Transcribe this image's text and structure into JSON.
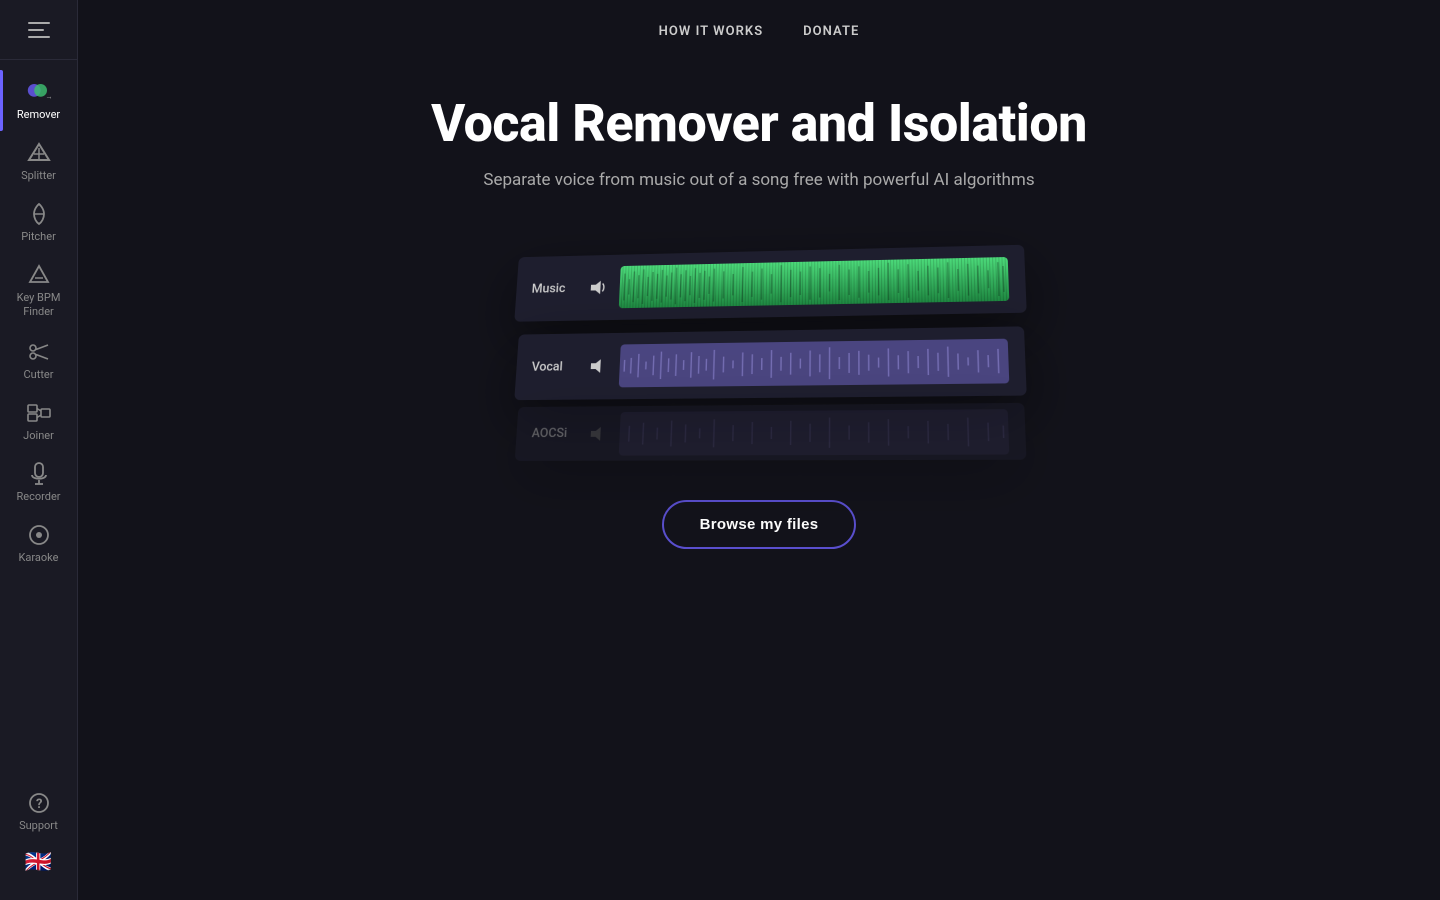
{
  "sidebar": {
    "hamburger_label": "Menu",
    "items": [
      {
        "id": "remover",
        "label": "Remover",
        "active": true
      },
      {
        "id": "splitter",
        "label": "Splitter",
        "active": false
      },
      {
        "id": "pitcher",
        "label": "Pitcher",
        "active": false
      },
      {
        "id": "keybpm",
        "label": "Key BPM Finder",
        "active": false
      },
      {
        "id": "cutter",
        "label": "Cutter",
        "active": false
      },
      {
        "id": "joiner",
        "label": "Joiner",
        "active": false
      },
      {
        "id": "recorder",
        "label": "Recorder",
        "active": false
      },
      {
        "id": "karaoke",
        "label": "Karaoke",
        "active": false
      }
    ],
    "bottom_items": [
      {
        "id": "support",
        "label": "Support"
      }
    ],
    "language": "🇬🇧"
  },
  "nav": {
    "items": [
      {
        "id": "how-it-works",
        "label": "HOW IT WORKS"
      },
      {
        "id": "donate",
        "label": "DONATE"
      }
    ]
  },
  "hero": {
    "title": "Vocal Remover and Isolation",
    "subtitle": "Separate voice from music out of a song free with powerful AI algorithms",
    "waveform": {
      "tracks": [
        {
          "id": "music",
          "label": "Music"
        },
        {
          "id": "vocal",
          "label": "Vocal"
        },
        {
          "id": "aocs",
          "label": "AOCSi"
        }
      ]
    },
    "browse_button": "Browse my files"
  }
}
